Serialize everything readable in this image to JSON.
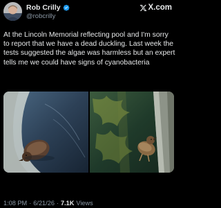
{
  "author": {
    "name": "Rob Crilly",
    "handle": "@robcrilly",
    "verified": true
  },
  "brand": {
    "label": "X.com"
  },
  "tweet": {
    "text": "At the Lincoln Memorial reflecting pool and I'm sorry to report that we have a dead duckling. Last week the tests suggested the algae was harmless but an expert tells me we could have signs of cyanobacteria"
  },
  "media": {
    "photos": [
      {
        "subject": "duckling-in-water"
      },
      {
        "subject": "duckling-on-pool-edge"
      }
    ]
  },
  "meta": {
    "time": "1:08 PM",
    "sep1": "·",
    "date": "6/21/26",
    "sep2": "·",
    "views_count": "7.1K",
    "views_label": "Views"
  },
  "colors": {
    "background": "#000000",
    "text": "#e7e9ea",
    "secondary_text": "#8b98a5",
    "verified_badge": "#1d9bf0"
  }
}
